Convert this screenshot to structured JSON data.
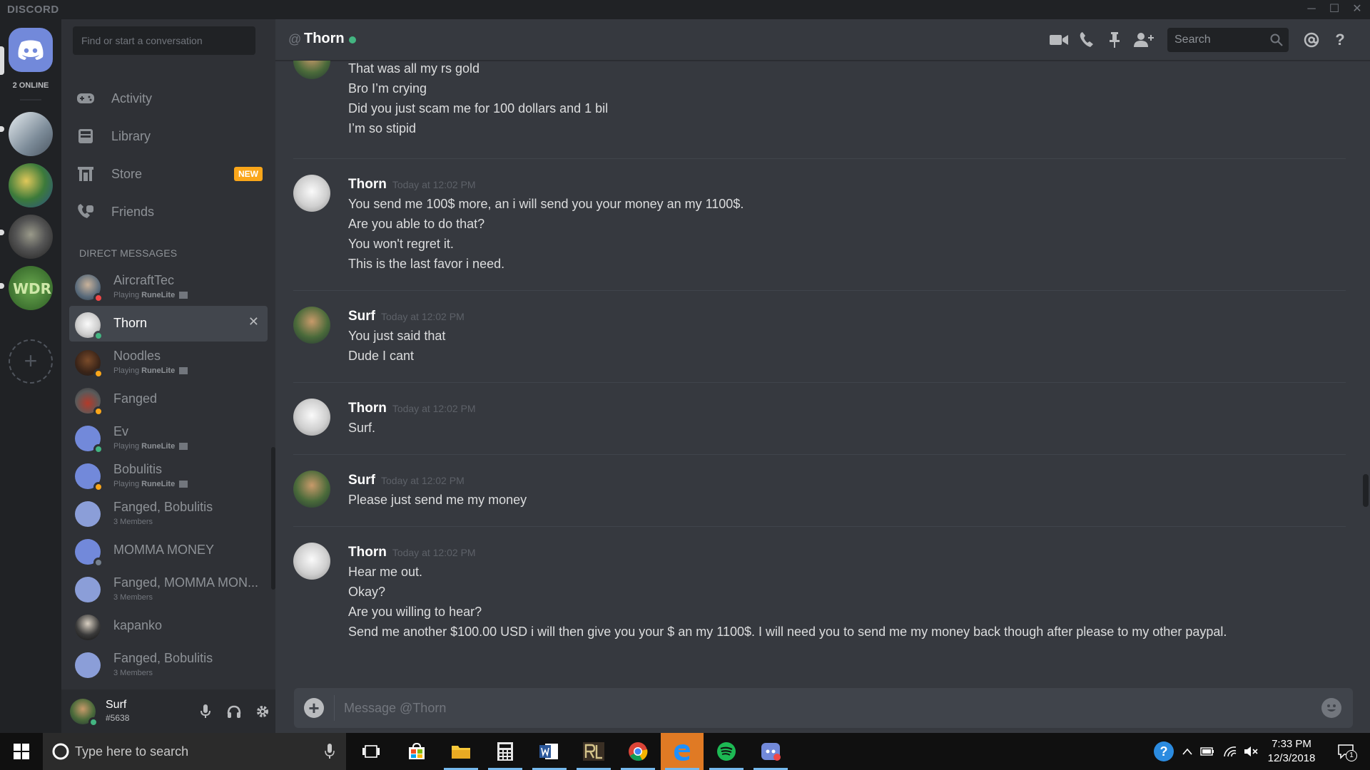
{
  "window": {
    "brand": "DISCORD",
    "minimize": "─",
    "maximize": "☐",
    "close": "✕"
  },
  "servers": {
    "online_label": "2 ONLINE",
    "add": "+"
  },
  "sidebar": {
    "search_placeholder": "Find or start a conversation",
    "nav": [
      {
        "label": "Activity",
        "icon": "gamepad-icon"
      },
      {
        "label": "Library",
        "icon": "library-icon"
      },
      {
        "label": "Store",
        "icon": "store-icon",
        "badge": "NEW"
      },
      {
        "label": "Friends",
        "icon": "friends-icon"
      }
    ],
    "dm_header": "DIRECT MESSAGES",
    "dms": [
      {
        "name": "AircraftTec",
        "sub_prefix": "Playing",
        "sub_game": "RuneLite",
        "status": "dnd"
      },
      {
        "name": "Thorn",
        "status": "online",
        "active": true,
        "close": "✕"
      },
      {
        "name": "Noodles",
        "sub_prefix": "Playing",
        "sub_game": "RuneLite",
        "status": "idle"
      },
      {
        "name": "Fanged",
        "status": "idle"
      },
      {
        "name": "Ev",
        "sub_prefix": "Playing",
        "sub_game": "RuneLite",
        "status": "online"
      },
      {
        "name": "Bobulitis",
        "sub_prefix": "Playing",
        "sub_game": "RuneLite",
        "status": "idle"
      },
      {
        "name": "Fanged, Bobulitis",
        "sub": "3 Members"
      },
      {
        "name": "MOMMA MONEY",
        "status": "offline"
      },
      {
        "name": "Fanged, MOMMA MON...",
        "sub": "3 Members"
      },
      {
        "name": "kapanko"
      },
      {
        "name": "Fanged, Bobulitis",
        "sub": "3 Members"
      }
    ]
  },
  "user": {
    "name": "Surf",
    "tag": "#5638"
  },
  "chat": {
    "channel_at": "@",
    "channel": "Thorn",
    "search_placeholder": "Search",
    "composer_placeholder": "Message @Thorn",
    "groups": [
      {
        "author": "",
        "time": "",
        "lines": [
          "That was all my rs gold",
          "Bro I’m crying",
          "Did you just scam me for 100 dollars and 1 bil",
          "I’m so stipid"
        ]
      },
      {
        "author": "Thorn",
        "time": "Today at 12:02 PM",
        "lines": [
          "You send me 100$ more, an i will send you your money an my 1100$.",
          "Are you able to do that?",
          "You won't regret it.",
          "This is the last favor i need."
        ]
      },
      {
        "author": "Surf",
        "time": "Today at 12:02 PM",
        "lines": [
          "You just said that",
          "Dude I cant"
        ]
      },
      {
        "author": "Thorn",
        "time": "Today at 12:02 PM",
        "lines": [
          "Surf."
        ]
      },
      {
        "author": "Surf",
        "time": "Today at 12:02 PM",
        "lines": [
          "Please just send me my money"
        ]
      },
      {
        "author": "Thorn",
        "time": "Today at 12:02 PM",
        "lines": [
          "Hear me out.",
          "Okay?",
          "Are you willing to hear?",
          "Send me another $100.00 USD i will then give you your $ an my 1100$. I will need you to send me my money back though after please to my other paypal."
        ]
      }
    ]
  },
  "taskbar": {
    "search_placeholder": "Type here to search",
    "time": "7:33 PM",
    "date": "12/3/2018",
    "notif_count": "1",
    "help_badge": "?"
  },
  "colors": {
    "online": "#43b581",
    "idle": "#faa61a",
    "dnd": "#f04747",
    "offline": "#747f8d",
    "blurple": "#7289da"
  }
}
